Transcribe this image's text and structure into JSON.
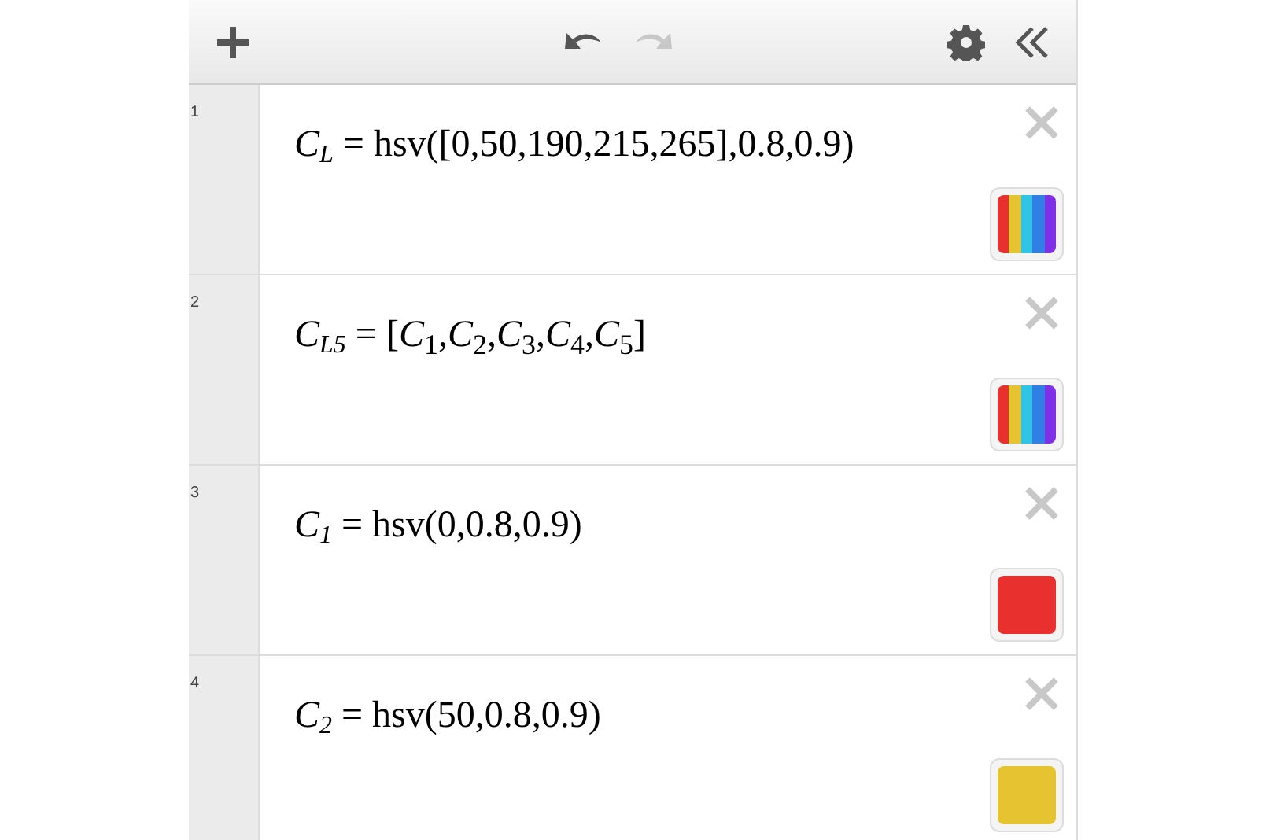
{
  "toolbar": {
    "undo": {
      "disabled": false
    },
    "redo": {
      "disabled": true
    }
  },
  "expressions": [
    {
      "number": "1",
      "var": "C",
      "sub": "L",
      "rhs": "= hsv([0,50,190,215,265],0.8,0.9)",
      "swatch": [
        {
          "color": "#e8302f"
        },
        {
          "color": "#e6c330"
        },
        {
          "color": "#2fc3e6"
        },
        {
          "color": "#2f7fe6"
        },
        {
          "color": "#7f2fe6"
        }
      ]
    },
    {
      "number": "2",
      "var": "C",
      "sub": "L5",
      "rhs": "= [*C*$_{1}$,*C*$_{2}$,*C*$_{3}$,*C*$_{4}$,*C*$_{5}$]",
      "swatch": [
        {
          "color": "#e8302f"
        },
        {
          "color": "#e6c330"
        },
        {
          "color": "#2fc3e6"
        },
        {
          "color": "#2f7fe6"
        },
        {
          "color": "#7f2fe6"
        }
      ]
    },
    {
      "number": "3",
      "var": "C",
      "sub": "1",
      "rhs": "= hsv(0,0.8,0.9)",
      "swatch": [
        {
          "color": "#e8302f"
        }
      ]
    },
    {
      "number": "4",
      "var": "C",
      "sub": "2",
      "rhs": "= hsv(50,0.8,0.9)",
      "swatch": [
        {
          "color": "#e6c330"
        }
      ]
    }
  ]
}
